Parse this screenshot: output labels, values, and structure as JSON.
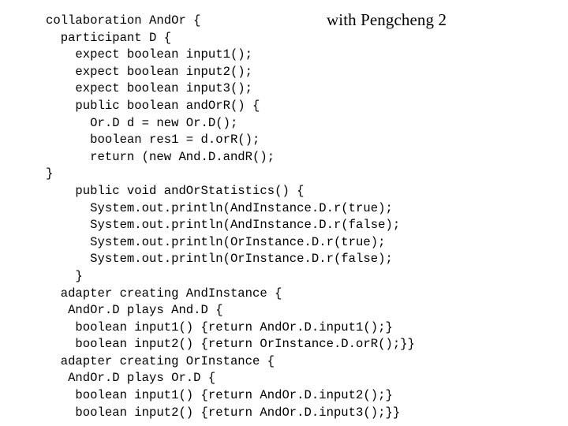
{
  "slide": {
    "title": "with Pengcheng 2",
    "background_color": "#ffffff",
    "text_color": "#000000"
  },
  "code": {
    "language": "java-collaboration-dsl",
    "lines": [
      "collaboration AndOr {",
      "  participant D {",
      "    expect boolean input1();",
      "    expect boolean input2();",
      "    expect boolean input3();",
      "    public boolean andOrR() {",
      "      Or.D d = new Or.D();",
      "      boolean res1 = d.orR();",
      "      return (new And.D.andR();",
      "}",
      "    public void andOrStatistics() {",
      "      System.out.println(AndInstance.D.r(true);",
      "      System.out.println(AndInstance.D.r(false);",
      "      System.out.println(OrInstance.D.r(true);",
      "      System.out.println(OrInstance.D.r(false);",
      "    }",
      "  adapter creating AndInstance {",
      "   AndOr.D plays And.D {",
      "    boolean input1() {return AndOr.D.input1();}",
      "    boolean input2() {return OrInstance.D.orR();}}",
      "  adapter creating OrInstance {",
      "   AndOr.D plays Or.D {",
      "    boolean input1() {return AndOr.D.input2();}",
      "    boolean input2() {return AndOr.D.input3();}}"
    ]
  }
}
